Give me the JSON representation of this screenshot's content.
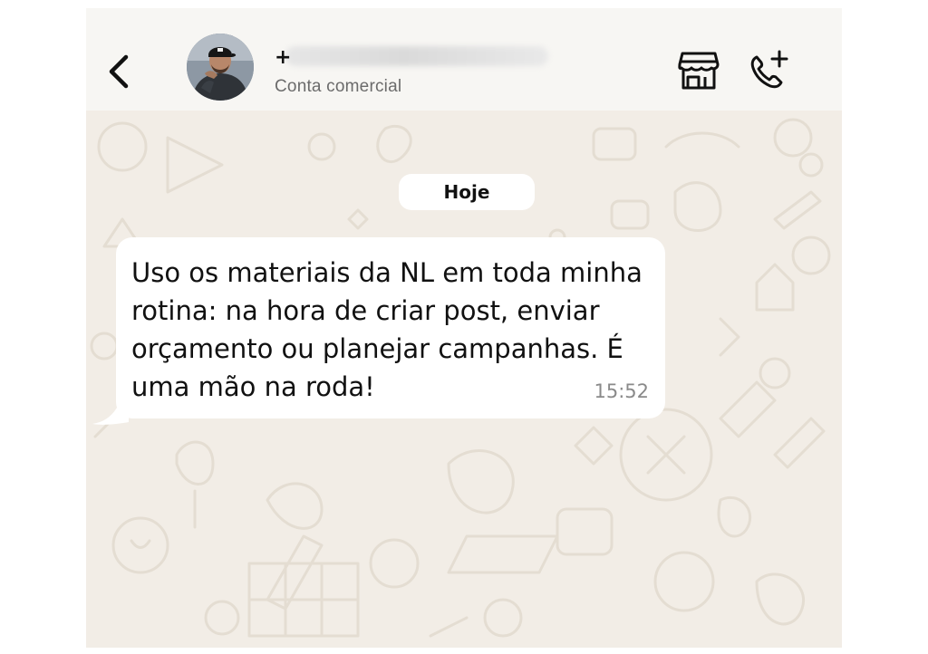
{
  "header": {
    "back_icon": "chevron-left-icon",
    "contact_prefix": "+",
    "contact_subtitle": "Conta comercial",
    "store_icon": "storefront-icon",
    "call_icon": "add-call-icon"
  },
  "chat": {
    "date_label": "Hoje",
    "messages": [
      {
        "text": "Uso os materiais da NL em toda minha\nrotina: na hora de criar post, enviar\norçamento ou planejar campanhas. É\numa mão na roda!",
        "time": "15:52",
        "direction": "incoming"
      }
    ]
  },
  "colors": {
    "header_bg": "#f7f6f3",
    "wallpaper_bg": "#f2ede6",
    "bubble_bg": "#ffffff",
    "time_text": "#8a8a8a"
  }
}
